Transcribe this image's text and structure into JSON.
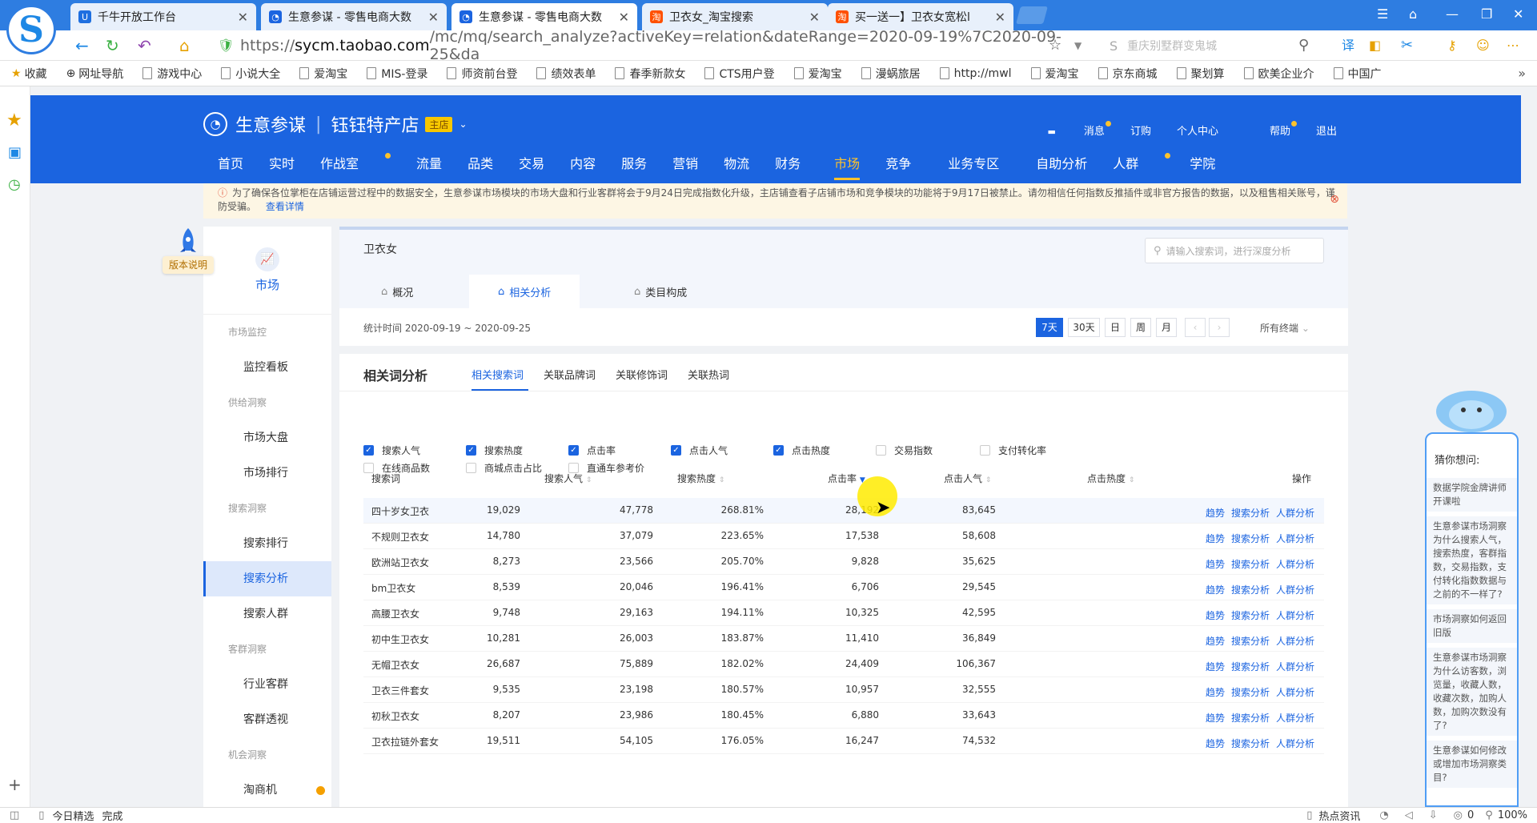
{
  "browser": {
    "tabs": [
      {
        "label": "千牛开放工作台",
        "active": false
      },
      {
        "label": "生意参谋 - 零售电商大数",
        "active": false
      },
      {
        "label": "生意参谋 - 零售电商大数",
        "active": true
      },
      {
        "label": "卫衣女_淘宝搜索",
        "active": false
      },
      {
        "label": "买一送一】卫衣女宽松l",
        "active": false
      }
    ],
    "url_scheme": "https://",
    "url_host": "sycm.taobao.com",
    "url_path": "/mc/mq/search_analyze?activeKey=relation&dateRange=2020-09-19%7C2020-09-25&da",
    "search_placeholder": "重庆别墅群变鬼城",
    "bookmarks": [
      "收藏",
      "网址导航",
      "游戏中心",
      "小说大全",
      "爱淘宝",
      "MIS-登录",
      "师资前台登",
      "绩效表单",
      "春季新款女",
      "CTS用户登",
      "爱淘宝",
      "漫蜗旅居",
      "http://mwl",
      "爱淘宝",
      "京东商城",
      "聚划算",
      "欧美企业介",
      "中国广"
    ]
  },
  "header": {
    "brand": "生意参谋",
    "shop": "钰钰特产店",
    "shop_badge": "主店",
    "user_nav": [
      "消息",
      "订购",
      "个人中心",
      "帮助",
      "退出"
    ],
    "main_nav": [
      "首页",
      "实时",
      "作战室",
      "流量",
      "品类",
      "交易",
      "内容",
      "服务",
      "营销",
      "物流",
      "财务",
      "市场",
      "竞争",
      "业务专区",
      "自助分析",
      "人群",
      "学院"
    ],
    "active_nav": "市场"
  },
  "notice": {
    "text": "为了确保各位掌柜在店铺运营过程中的数据安全，生意参谋市场模块的市场大盘和行业客群将会于9月24日完成指数化升级，主店铺查看子店铺市场和竞争模块的功能将于9月17日被禁止。请勿相信任何指数反推插件或非官方报告的数据，以及租售相关账号，谨防受骗。",
    "link": "查看详情"
  },
  "left_menu": {
    "badge": "版本说明",
    "title": "市场",
    "groups": [
      {
        "label": "市场监控",
        "items": [
          "监控看板"
        ]
      },
      {
        "label": "供给洞察",
        "items": [
          "市场大盘",
          "市场排行"
        ]
      },
      {
        "label": "搜索洞察",
        "items": [
          "搜索排行",
          "搜索分析",
          "搜索人群"
        ]
      },
      {
        "label": "客群洞察",
        "items": [
          "行业客群",
          "客群透视"
        ]
      },
      {
        "label": "机会洞察",
        "items": [
          "淘商机"
        ]
      }
    ],
    "active_item": "搜索分析"
  },
  "top_card": {
    "keyword": "卫衣女",
    "search_placeholder": "请输入搜索词，进行深度分析",
    "tabs": [
      "概况",
      "相关分析",
      "类目构成"
    ],
    "active_tab": "相关分析",
    "period_label": "统计时间 2020-09-19 ~ 2020-09-25",
    "period_buttons": [
      "7天",
      "30天",
      "日",
      "周",
      "月"
    ],
    "active_period": "7天",
    "terminal": "所有终端"
  },
  "analysis": {
    "title": "相关词分析",
    "sub_tabs": [
      "相关搜索词",
      "关联品牌词",
      "关联修饰词",
      "关联热词"
    ],
    "checkboxes": [
      {
        "label": "搜索人气",
        "checked": true
      },
      {
        "label": "搜索热度",
        "checked": true
      },
      {
        "label": "点击率",
        "checked": true
      },
      {
        "label": "点击人气",
        "checked": true
      },
      {
        "label": "点击热度",
        "checked": true
      },
      {
        "label": "交易指数",
        "checked": false
      },
      {
        "label": "支付转化率",
        "checked": false
      },
      {
        "label": "在线商品数",
        "checked": false
      },
      {
        "label": "商城点击占比",
        "checked": false
      },
      {
        "label": "直通车参考价",
        "checked": false
      }
    ],
    "columns": [
      "搜索词",
      "搜索人气",
      "搜索热度",
      "点击率",
      "点击人气",
      "点击热度",
      "操作"
    ],
    "actions": [
      "趋势",
      "搜索分析",
      "人群分析"
    ],
    "rows": [
      [
        "四十岁女卫衣",
        "19,029",
        "47,778",
        "268.81%",
        "28,192",
        "83,645"
      ],
      [
        "不规则卫衣女",
        "14,780",
        "37,079",
        "223.65%",
        "17,538",
        "58,608"
      ],
      [
        "欧洲站卫衣女",
        "8,273",
        "23,566",
        "205.70%",
        "9,828",
        "35,625"
      ],
      [
        "bm卫衣女",
        "8,539",
        "20,046",
        "196.41%",
        "6,706",
        "29,545"
      ],
      [
        "高腰卫衣女",
        "9,748",
        "29,163",
        "194.11%",
        "10,325",
        "42,595"
      ],
      [
        "初中生卫衣女",
        "10,281",
        "26,003",
        "183.87%",
        "11,410",
        "36,849"
      ],
      [
        "无帽卫衣女",
        "26,687",
        "75,889",
        "182.02%",
        "24,409",
        "106,367"
      ],
      [
        "卫衣三件套女",
        "9,535",
        "23,198",
        "180.57%",
        "10,957",
        "32,555"
      ],
      [
        "初秋卫衣女",
        "8,207",
        "23,986",
        "180.45%",
        "6,880",
        "33,643"
      ],
      [
        "卫衣拉链外套女",
        "19,511",
        "54,105",
        "176.05%",
        "16,247",
        "74,532"
      ]
    ]
  },
  "helper": {
    "title": "猜你想问:",
    "questions": [
      "数据学院金牌讲师开课啦",
      "生意参谋市场洞察为什么搜索人气，搜索热度，客群指数，交易指数，支付转化指数数据与之前的不一样了?",
      "市场洞察如何返回旧版",
      "生意参谋市场洞察为什么访客数，浏览量，收藏人数，收藏次数，加购人数，加购次数没有了?",
      "生意参谋如何修改或增加市场洞察类目?"
    ]
  },
  "status": {
    "left": "今日精选",
    "state": "完成",
    "news": "热点资讯",
    "count": "0",
    "zoom": "100%"
  }
}
